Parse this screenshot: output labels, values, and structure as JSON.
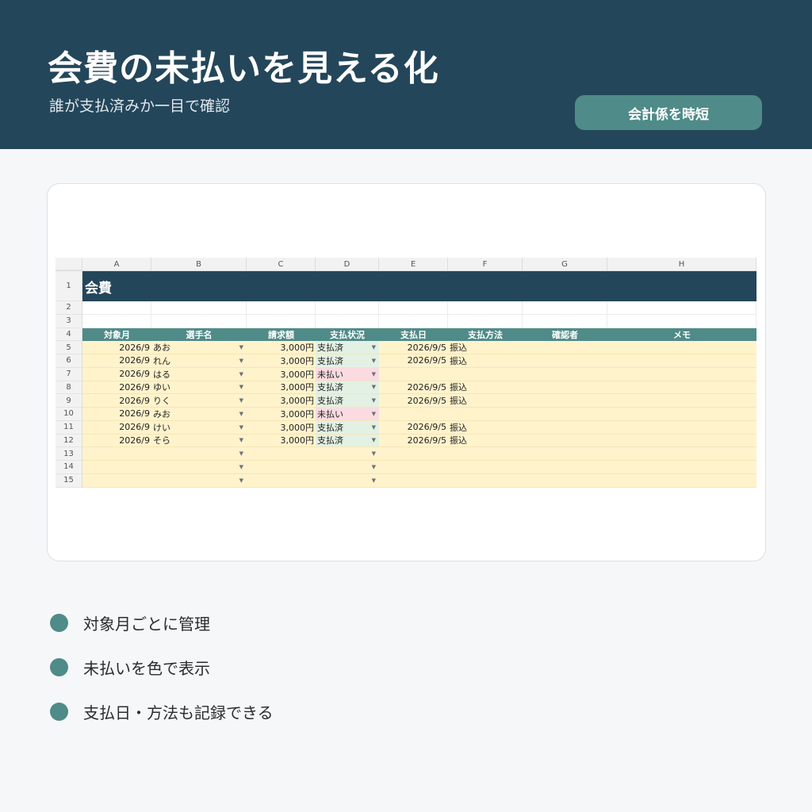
{
  "header": {
    "title": "会費の未払いを見える化",
    "subtitle": "誰が支払済みか一目で確認",
    "badge": "会計係を時短"
  },
  "sheet": {
    "columns": [
      "A",
      "B",
      "C",
      "D",
      "E",
      "F",
      "G",
      "H"
    ],
    "row_numbers": [
      "1",
      "2",
      "3",
      "4",
      "5",
      "6",
      "7",
      "8",
      "9",
      "10",
      "11",
      "12",
      "13",
      "14",
      "15"
    ],
    "banner": "会費",
    "headers": [
      "対象月",
      "選手名",
      "請求額",
      "支払状況",
      "支払日",
      "支払方法",
      "確認者",
      "メモ"
    ],
    "rows": [
      {
        "month": "2026/9",
        "name": "あお",
        "amount": "3,000円",
        "status": "支払済",
        "date": "2026/9/5",
        "method": "振込",
        "paid": true
      },
      {
        "month": "2026/9",
        "name": "れん",
        "amount": "3,000円",
        "status": "支払済",
        "date": "2026/9/5",
        "method": "振込",
        "paid": true
      },
      {
        "month": "2026/9",
        "name": "はる",
        "amount": "3,000円",
        "status": "未払い",
        "date": "",
        "method": "",
        "paid": false
      },
      {
        "month": "2026/9",
        "name": "ゆい",
        "amount": "3,000円",
        "status": "支払済",
        "date": "2026/9/5",
        "method": "振込",
        "paid": true
      },
      {
        "month": "2026/9",
        "name": "りく",
        "amount": "3,000円",
        "status": "支払済",
        "date": "2026/9/5",
        "method": "振込",
        "paid": true
      },
      {
        "month": "2026/9",
        "name": "みお",
        "amount": "3,000円",
        "status": "未払い",
        "date": "",
        "method": "",
        "paid": false
      },
      {
        "month": "2026/9",
        "name": "けい",
        "amount": "3,000円",
        "status": "支払済",
        "date": "2026/9/5",
        "method": "振込",
        "paid": true
      },
      {
        "month": "2026/9",
        "name": "そら",
        "amount": "3,000円",
        "status": "支払済",
        "date": "2026/9/5",
        "method": "振込",
        "paid": true
      },
      {
        "month": "",
        "name": "",
        "amount": "",
        "status": "",
        "date": "",
        "method": "",
        "paid": null
      },
      {
        "month": "",
        "name": "",
        "amount": "",
        "status": "",
        "date": "",
        "method": "",
        "paid": null
      },
      {
        "month": "",
        "name": "",
        "amount": "",
        "status": "",
        "date": "",
        "method": "",
        "paid": null
      }
    ],
    "dropdown_icon": "chevron-down-icon"
  },
  "features": [
    "対象月ごとに管理",
    "未払いを色で表示",
    "支払日・方法も記録できる"
  ],
  "colors": {
    "header_bg": "#24465a",
    "accent": "#4f8b88",
    "data_bg": "#fff3cc",
    "paid_bg": "#e3f1e4",
    "unpaid_bg": "#fadbe2"
  }
}
